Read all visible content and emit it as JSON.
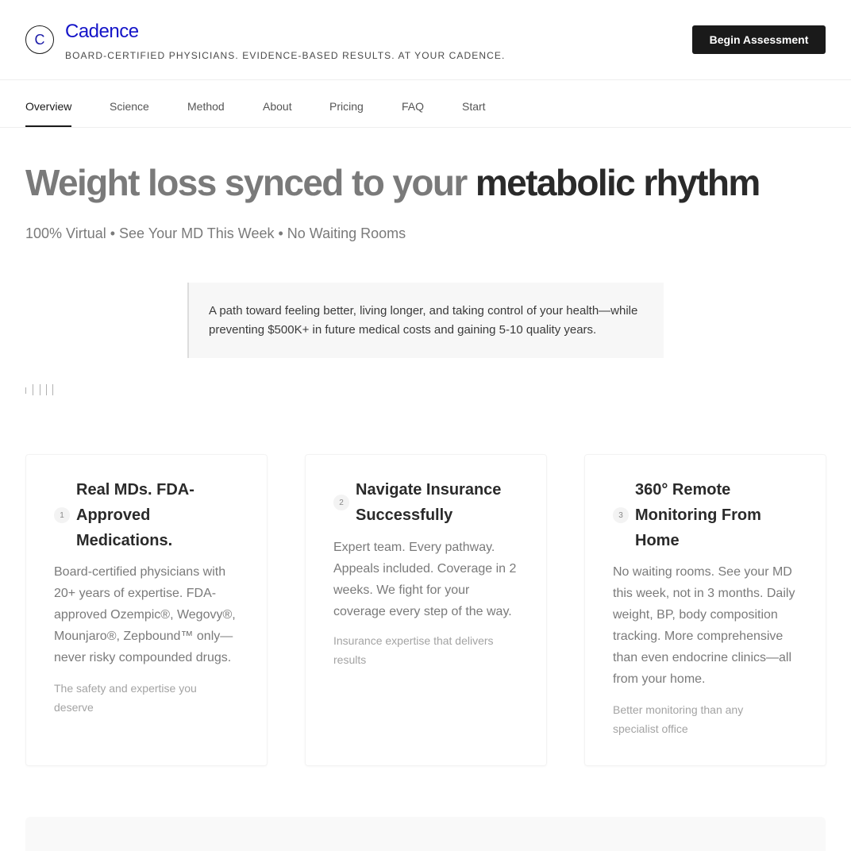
{
  "brand": {
    "logo_letter": "C",
    "name": "Cadence",
    "tagline": "BOARD-CERTIFIED PHYSICIANS. EVIDENCE-BASED RESULTS. AT YOUR CADENCE.",
    "cta_label": "Begin Assessment"
  },
  "nav": {
    "tabs": [
      {
        "label": "Overview"
      },
      {
        "label": "Science"
      },
      {
        "label": "Method"
      },
      {
        "label": "About"
      },
      {
        "label": "Pricing"
      },
      {
        "label": "FAQ"
      },
      {
        "label": "Start"
      }
    ],
    "active": "Overview"
  },
  "hero": {
    "title_light": "Weight loss synced to your ",
    "title_strong": "metabolic rhythm",
    "subtitle": "100% Virtual • See Your MD This Week • No Waiting Rooms",
    "quote": "A path toward feeling better, living longer, and taking control of your health—while preventing $500K+ in future medical costs and gaining 5-10 quality years."
  },
  "cards": [
    {
      "number": "1",
      "title": "Real MDs. FDA-Approved Medications.",
      "description": "Board-certified physicians with 20+ years of expertise. FDA-approved Ozempic®, Wegovy®, Mounjaro®, Zepbound™ only—never risky compounded drugs.",
      "footnote": "The safety and expertise you deserve"
    },
    {
      "number": "2",
      "title": "Navigate Insurance Successfully",
      "description": "Expert team. Every pathway. Appeals included. Coverage in 2 weeks. We fight for your coverage every step of the way.",
      "footnote": "Insurance expertise that delivers results"
    },
    {
      "number": "3",
      "title": "360° Remote Monitoring From Home",
      "description": "No waiting rooms. See your MD this week, not in 3 months. Daily weight, BP, body composition tracking. More comprehensive than even endocrine clinics—all from your home.",
      "footnote": "Better monitoring than any specialist office"
    }
  ],
  "colors": {
    "brand_blue": "#1414c8",
    "cta_background": "#1a1a1a",
    "hero_light": "#7a7a7a",
    "hero_strong": "#2a2a2a"
  }
}
